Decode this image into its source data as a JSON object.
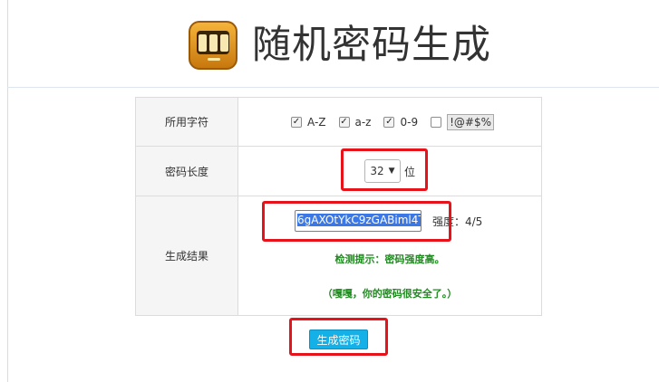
{
  "header": {
    "title": "随机密码生成",
    "logo_icon": "slot-machine-icon"
  },
  "form": {
    "charset": {
      "label": "所用字符",
      "options": [
        {
          "text": "A-Z",
          "checked": true
        },
        {
          "text": "a-z",
          "checked": true
        },
        {
          "text": "0-9",
          "checked": true
        },
        {
          "text": "!@#$%",
          "checked": false
        }
      ]
    },
    "length": {
      "label": "密码长度",
      "value": "32",
      "unit": "位"
    },
    "result": {
      "label": "生成结果",
      "password": "6gAXOtYkC9zGABiml4T",
      "strength": "强度：4/5",
      "hint1": "检测提示：密码强度高。",
      "hint2": "（嘎嘎，你的密码很安全了。）"
    }
  },
  "generate_button": "生成密码",
  "annotation_color": "#e8121b"
}
